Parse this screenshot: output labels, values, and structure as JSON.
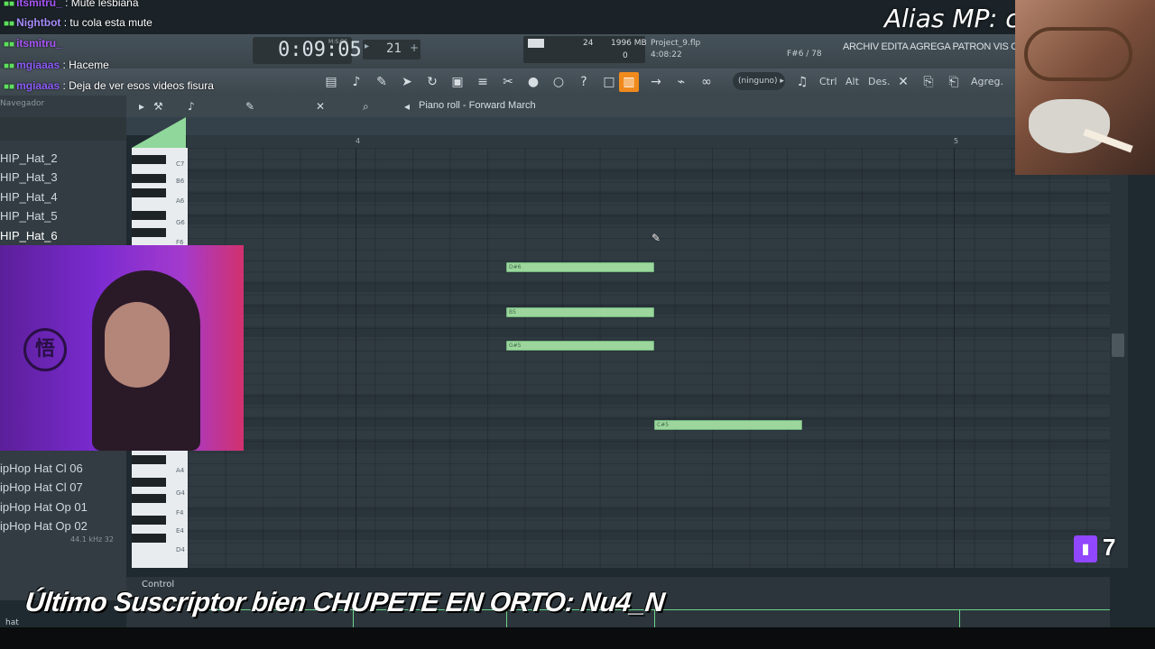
{
  "chat": [
    {
      "user": "itsmitru_",
      "message": "Mute lesbiana",
      "user_color": "#a855f7"
    },
    {
      "user": "Nightbot",
      "message": "tu cola esta mute",
      "user_color": "#a78bfa"
    },
    {
      "user": "itsmitru_",
      "message": "",
      "user_color": "#a855f7"
    },
    {
      "user": "mgiaaas",
      "message": "Haceme",
      "user_color": "#8b5cf6"
    },
    {
      "user": "mgiaaas",
      "message": "Deja de ver esos videos fisura",
      "user_color": "#8b5cf6"
    }
  ],
  "overlay": {
    "alias_text": "Alias MP: c",
    "subscriber_text": "Último Suscriptor bien CHUPETE EN ORTO: Nu4_N",
    "viewer_count": "7"
  },
  "transport": {
    "time": "0:09:05",
    "time_label": "M:S:CS",
    "tempo": "21",
    "plus": "+",
    "minus": "▸"
  },
  "monitor": {
    "cpu": "24",
    "ram": "1996 MB",
    "polyphony": "0"
  },
  "project": {
    "name": "Project_9.flp",
    "elapsed": "4:08:22",
    "note_info": "F#6 / 78"
  },
  "menu": {
    "labels": "ARCHIV EDITA AGREGA PATRON VIS OPCIONES"
  },
  "toolbar": {
    "pattern_select": "(ninguno) ▸",
    "ctrl": "Ctrl",
    "alt": "Alt",
    "des": "Des.",
    "agreg": "Agreg."
  },
  "browser": {
    "header": "Navegador",
    "items": [
      "HIP_Hat_2",
      "HIP_Hat_3",
      "HIP_Hat_4",
      "HIP_Hat_5",
      "HIP_Hat_6",
      "ipHop Hat Cl 06",
      "ipHop Hat Cl 07",
      "ipHop Hat Op 01",
      "ipHop Hat Op 02"
    ],
    "selected_index": 4,
    "footer": "44.1 kHz 32",
    "search": "hat"
  },
  "piano_roll": {
    "title": "Piano roll - Forward March",
    "bar_numbers": [
      "4",
      "5"
    ],
    "key_labels": [
      "C7",
      "B6",
      "A6",
      "G6",
      "F6",
      "A4",
      "G4",
      "F4",
      "E4",
      "D4"
    ],
    "notes": [
      {
        "label": "D#6",
        "pitch": "D#6",
        "start": 4.5,
        "length": 1
      },
      {
        "label": "B5",
        "pitch": "B5",
        "start": 4.5,
        "length": 1
      },
      {
        "label": "G#5",
        "pitch": "G#5",
        "start": 4.5,
        "length": 1
      },
      {
        "label": "C#5",
        "pitch": "C#5",
        "start": 5.5,
        "length": 1
      }
    ],
    "event_lane_label": "Control",
    "accent_color": "#9cd69c",
    "active_tool_color": "#f08a1c"
  },
  "icons": {
    "pencil": "pencil-icon",
    "cursor": "cursor-icon"
  }
}
